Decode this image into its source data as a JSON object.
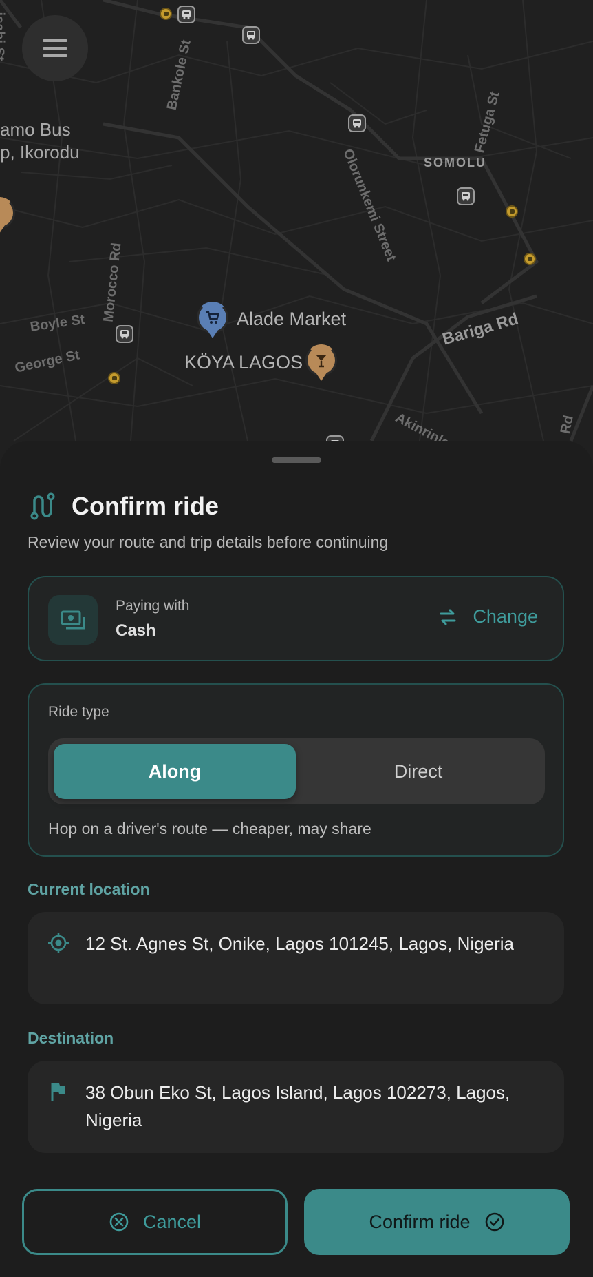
{
  "map": {
    "places": {
      "bus_stop": "amo Bus\np, Ikorodu",
      "alade_market": "Alade Market",
      "koya_lagos": "KÖYA LAGOS",
      "somolu": "SOMOLU"
    },
    "streets": {
      "isabi": "isabi St",
      "bankole": "Bankole St",
      "fetuga": "Fetuga St",
      "olorunkemi": "Olorunkemi Street",
      "morocco": "Morocco Rd",
      "boyle": "Boyle St",
      "george": "George St",
      "bariga": "Bariga Rd",
      "akinrinle": "Akinrinle",
      "rd_edge": "Rd"
    },
    "icons": {
      "menu": "hamburger-icon",
      "bus": "bus-stop-icon",
      "cart": "shopping-cart-icon",
      "cocktail": "cocktail-icon"
    }
  },
  "sheet": {
    "title": "Confirm ride",
    "subtitle": "Review your route and trip details before continuing",
    "payment": {
      "label": "Paying with",
      "value": "Cash",
      "change_label": "Change"
    },
    "ride_type": {
      "label": "Ride type",
      "options": [
        "Along",
        "Direct"
      ],
      "selected": "Along",
      "hint": "Hop on a driver's route — cheaper, may share"
    },
    "current_location": {
      "label": "Current location",
      "address": "12 St. Agnes St, Onike, Lagos 101245, Lagos, Nigeria"
    },
    "destination": {
      "label": "Destination",
      "address": "38 Obun Eko St, Lagos Island, Lagos 102273, Lagos, Nigeria"
    },
    "actions": {
      "cancel_label": "Cancel",
      "confirm_label": "Confirm ride"
    }
  },
  "colors": {
    "accent": "#3b8a89",
    "accent_text": "#3f9c9c",
    "background": "#1d1d1d",
    "map_background": "#202020"
  }
}
